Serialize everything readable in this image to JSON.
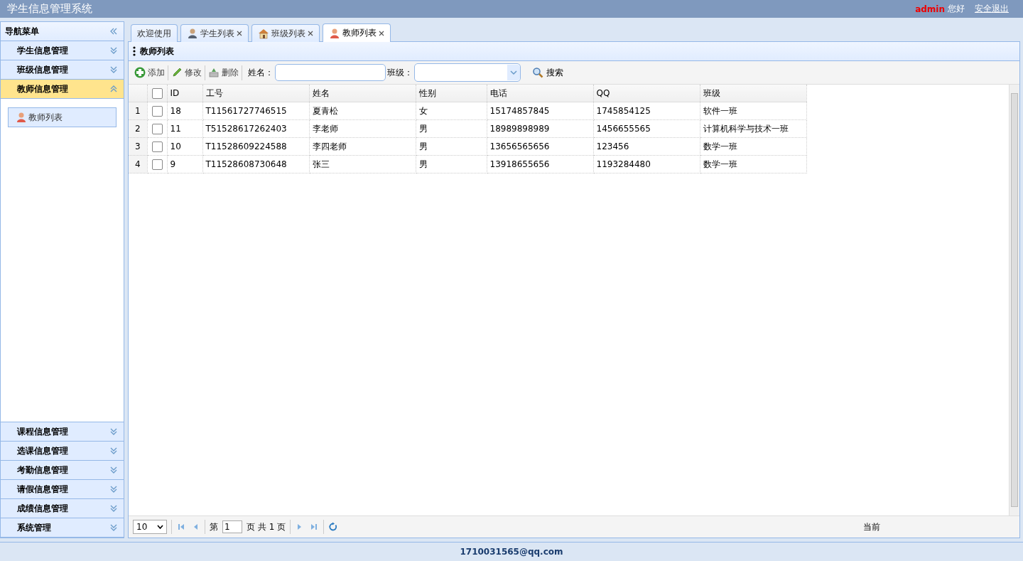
{
  "header": {
    "title": "学生信息管理系统",
    "user": "admin",
    "greeting": "您好",
    "logout": "安全退出"
  },
  "nav": {
    "title": "导航菜单",
    "sections": [
      {
        "label": "学生信息管理",
        "expanded": false
      },
      {
        "label": "班级信息管理",
        "expanded": false
      },
      {
        "label": "教师信息管理",
        "expanded": true,
        "children": [
          {
            "label": "教师列表",
            "kind": "teacher",
            "selected": true
          }
        ]
      },
      {
        "label": "课程信息管理",
        "expanded": false
      },
      {
        "label": "选课信息管理",
        "expanded": false
      },
      {
        "label": "考勤信息管理",
        "expanded": false
      },
      {
        "label": "请假信息管理",
        "expanded": false
      },
      {
        "label": "成绩信息管理",
        "expanded": false
      },
      {
        "label": "系统管理",
        "expanded": false
      }
    ]
  },
  "tabs": [
    {
      "label": "欢迎使用",
      "closable": false,
      "selected": false
    },
    {
      "label": "学生列表",
      "kind": "student",
      "closable": true,
      "selected": false
    },
    {
      "label": "班级列表",
      "kind": "house",
      "closable": true,
      "selected": false
    },
    {
      "label": "教师列表",
      "kind": "teacher",
      "closable": true,
      "selected": true
    }
  ],
  "panel": {
    "title": "教师列表"
  },
  "toolbar": {
    "buttons": [
      {
        "label": "添加",
        "kind": "add"
      },
      {
        "label": "修改",
        "kind": "edit"
      },
      {
        "label": "删除",
        "kind": "delete"
      }
    ],
    "name_label": "姓名：",
    "class_label": "班级：",
    "search": "搜索"
  },
  "table": {
    "header_checked": false,
    "columns": [
      "ID",
      "工号",
      "姓名",
      "性别",
      "电话",
      "QQ",
      "班级"
    ],
    "rows": [
      {
        "number": "1",
        "checked": false,
        "cells": [
          "18",
          "T11561727746515",
          "夏青松",
          "女",
          "15174857845",
          "1745854125",
          "软件一班"
        ]
      },
      {
        "number": "2",
        "checked": false,
        "cells": [
          "11",
          "T51528617262403",
          "李老师",
          "男",
          "18989898989",
          "1456655565",
          "计算机科学与技术一班"
        ]
      },
      {
        "number": "3",
        "checked": false,
        "cells": [
          "10",
          "T11528609224588",
          "李四老师",
          "男",
          "13656565656",
          "123456",
          "数学一班"
        ]
      },
      {
        "number": "4",
        "checked": false,
        "cells": [
          "9",
          "T11528608730648",
          "张三",
          "男",
          "13918655656",
          "1193284480",
          "数学一班"
        ]
      }
    ]
  },
  "pager": {
    "page_size": "10",
    "page_prefix": "第",
    "page": "1",
    "page_suffix": "页 共 1 页",
    "info": "当前"
  },
  "footer": "1710031565@qq.com"
}
